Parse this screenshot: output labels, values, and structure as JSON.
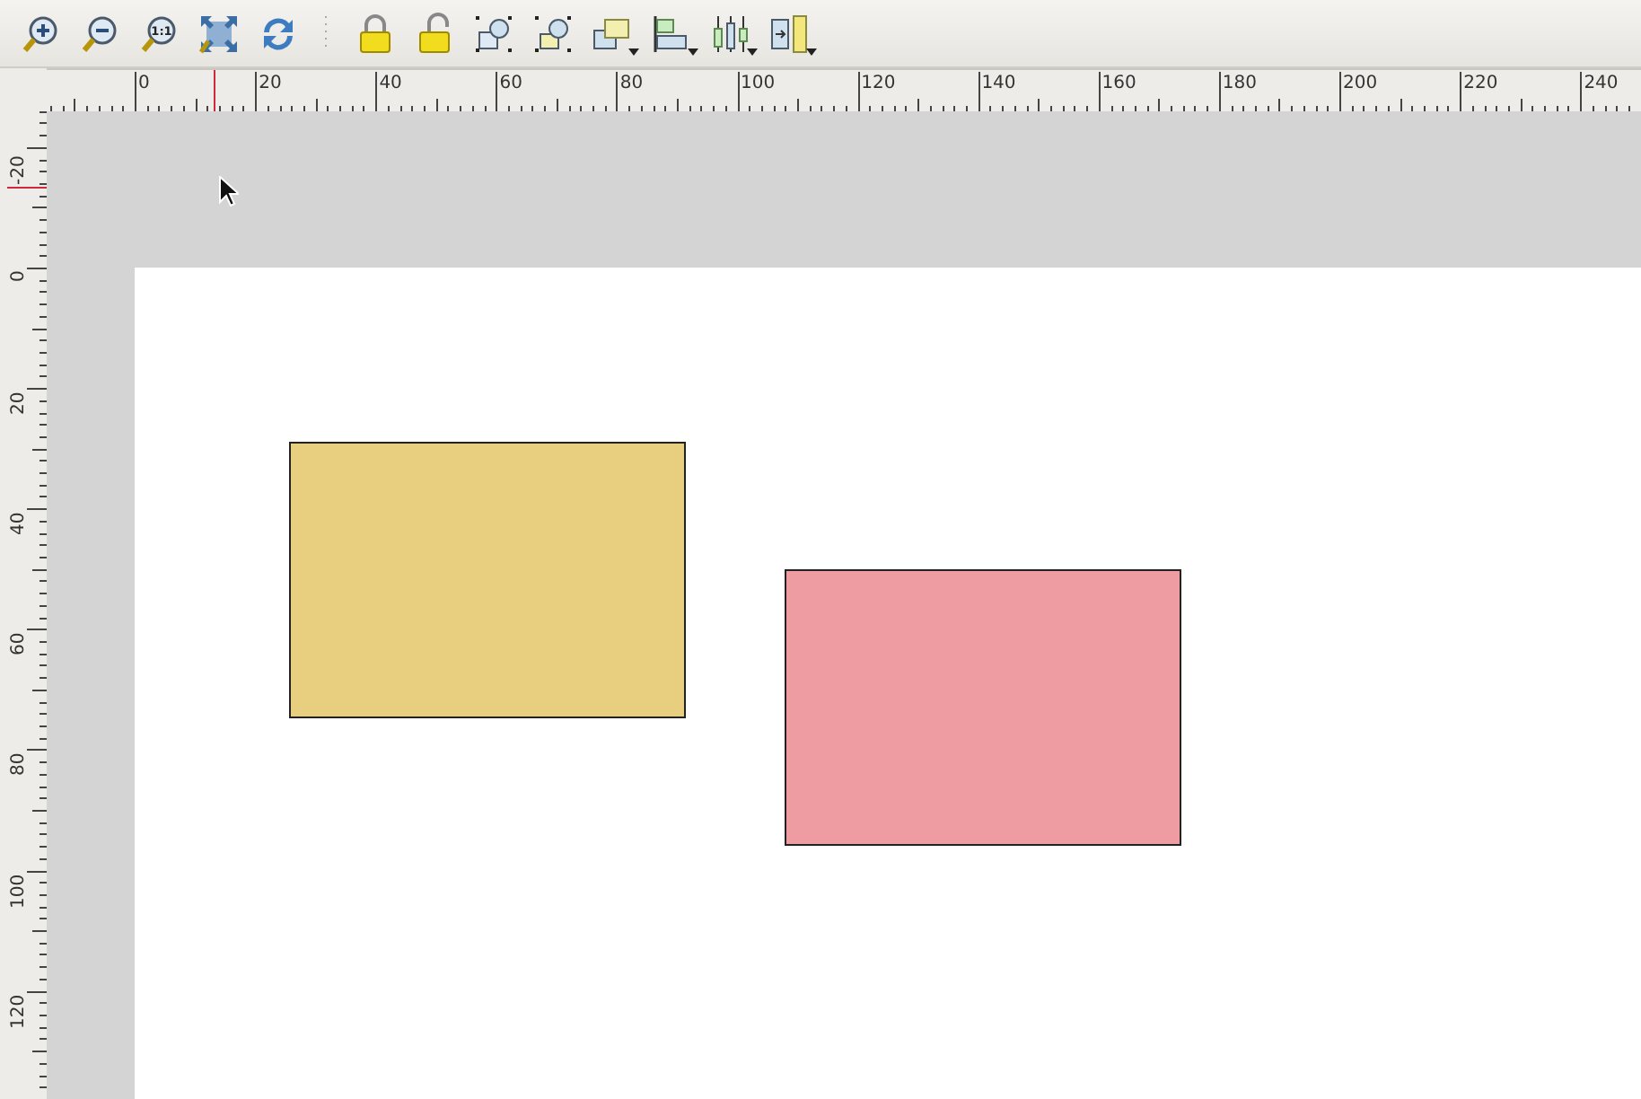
{
  "toolbar": {
    "items": [
      {
        "kind": "zoom-in",
        "has_menu": false
      },
      {
        "kind": "zoom-out",
        "has_menu": false
      },
      {
        "kind": "zoom-actual",
        "label": "1:1",
        "has_menu": false
      },
      {
        "kind": "zoom-full",
        "has_menu": false
      },
      {
        "kind": "refresh",
        "has_menu": false
      },
      {
        "kind": "separator"
      },
      {
        "kind": "lock",
        "has_menu": false
      },
      {
        "kind": "unlock",
        "has_menu": false
      },
      {
        "kind": "group",
        "has_menu": false
      },
      {
        "kind": "ungroup",
        "has_menu": false
      },
      {
        "kind": "raise",
        "has_menu": true
      },
      {
        "kind": "align",
        "has_menu": true
      },
      {
        "kind": "distribute",
        "has_menu": true
      },
      {
        "kind": "resize",
        "has_menu": true
      }
    ]
  },
  "ruler_top": {
    "labels": [
      "0",
      "20",
      "40",
      "60",
      "80",
      "100",
      "120",
      "140",
      "160",
      "180",
      "200",
      "220",
      "240"
    ]
  },
  "ruler_left": {
    "labels": [
      "-20",
      "0",
      "20",
      "40",
      "60",
      "80",
      "100",
      "120"
    ]
  },
  "canvas": {
    "shapes": [
      {
        "color": "#e8cf80"
      },
      {
        "color": "#ee9ba2"
      }
    ]
  }
}
